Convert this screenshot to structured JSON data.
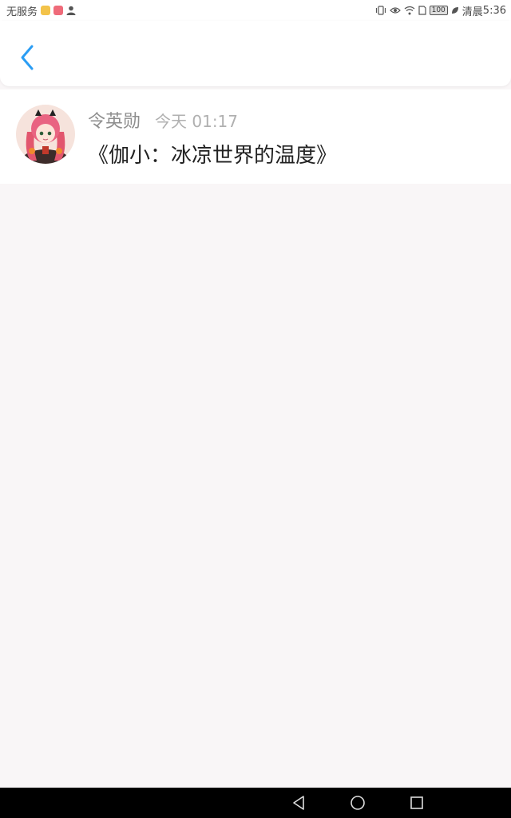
{
  "status_bar": {
    "carrier": "无服务",
    "battery": "100",
    "period": "清晨",
    "time": "5:36"
  },
  "header": {
    "back_icon": "chevron-left-icon"
  },
  "message": {
    "sender": "令英勋",
    "timestamp": "今天 01:17",
    "text": "《伽小：冰凉世界的温度》"
  },
  "nav": {
    "back": "triangle-back-icon",
    "home": "circle-home-icon",
    "recents": "square-recents-icon"
  },
  "colors": {
    "accent": "#2a9df4",
    "background": "#f9f6f7"
  }
}
